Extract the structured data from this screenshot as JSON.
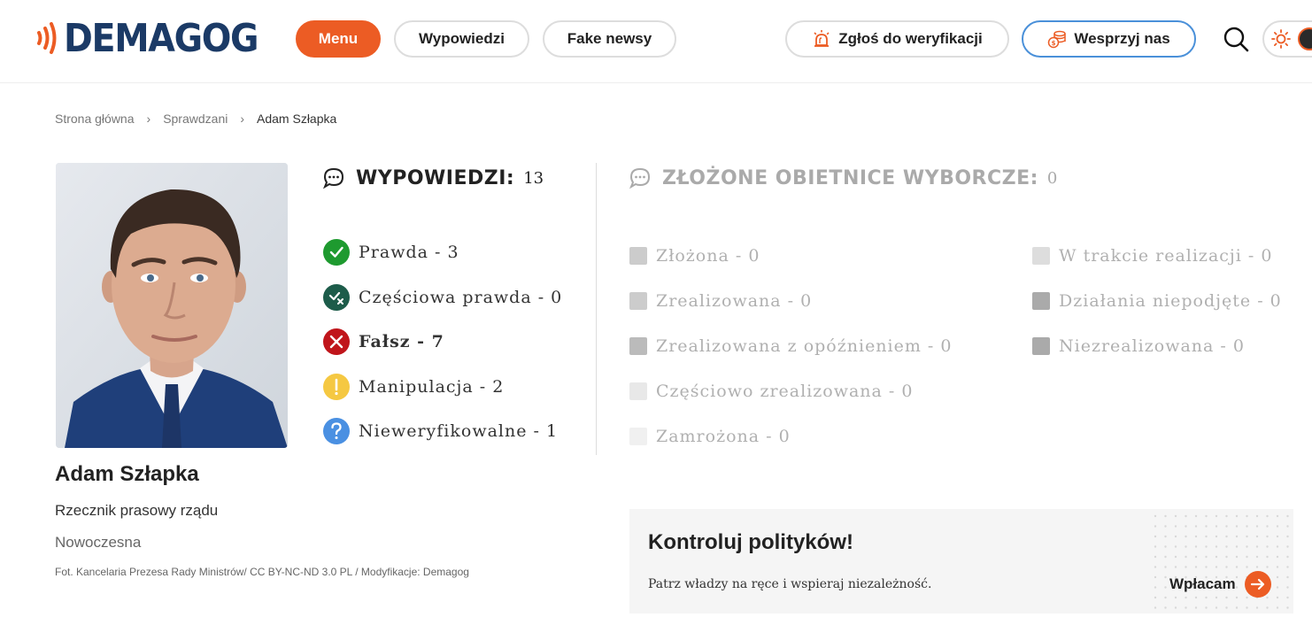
{
  "header": {
    "logo_text": "DEMAGOG",
    "nav": {
      "menu": "Menu",
      "statements": "Wypowiedzi",
      "fake_news": "Fake newsy",
      "report": "Zgłoś do weryfikacji",
      "support": "Wesprzyj nas"
    },
    "icons": {
      "report": "alarm-light-icon",
      "support": "coins-icon",
      "search": "search-icon",
      "theme": "sun-icon"
    }
  },
  "breadcrumb": {
    "home": "Strona główna",
    "section": "Sprawdzani",
    "current": "Adam Szłapka",
    "separator": "›"
  },
  "profile": {
    "name": "Adam Szłapka",
    "role": "Rzecznik prasowy rządu",
    "party": "Nowoczesna",
    "photo_credit": "Fot. Kancelaria Prezesa Rady Ministrów/ CC BY-NC-ND 3.0 PL / Modyfikacje: Demagog"
  },
  "statements": {
    "title": "WYPOWIEDZI:",
    "count": "13",
    "verdicts": [
      {
        "label": "Prawda - 3",
        "icon": "check-icon",
        "color": "#1e9a2f"
      },
      {
        "label": "Częściowa prawda - 0",
        "icon": "partial-check-icon",
        "color": "#1d5c4a"
      },
      {
        "label": "Fałsz - 7",
        "icon": "cross-icon",
        "color": "#c0151b"
      },
      {
        "label": "Manipulacja - 2",
        "icon": "exclamation-icon",
        "color": "#f5c842"
      },
      {
        "label": "Nieweryfikowalne - 1",
        "icon": "question-icon",
        "color": "#4a90e2"
      }
    ]
  },
  "promises": {
    "title": "ZŁOŻONE OBIETNICE WYBORCZE:",
    "count": "0",
    "col1": [
      {
        "label": "Złożona - 0",
        "color": "#cccccc"
      },
      {
        "label": "Zrealizowana - 0",
        "color": "#cccccc"
      },
      {
        "label": "Zrealizowana z opóźnieniem - 0",
        "color": "#bbbbbb"
      },
      {
        "label": "Częściowo zrealizowana - 0",
        "color": "#e8e8e8"
      },
      {
        "label": "Zamrożona - 0",
        "color": "#f0f0f0"
      }
    ],
    "col2": [
      {
        "label": "W trakcie realizacji - 0",
        "color": "#dddddd"
      },
      {
        "label": "Działania niepodjęte - 0",
        "color": "#aaaaaa"
      },
      {
        "label": "Niezrealizowana - 0",
        "color": "#aaaaaa"
      }
    ]
  },
  "cta": {
    "title": "Kontroluj polityków!",
    "subtitle": "Patrz władzy na ręce i wspieraj niezależność.",
    "button": "Wpłacam"
  },
  "colors": {
    "accent": "#ec5c24",
    "brand": "#1b3a66",
    "support_border": "#4a90d9"
  }
}
